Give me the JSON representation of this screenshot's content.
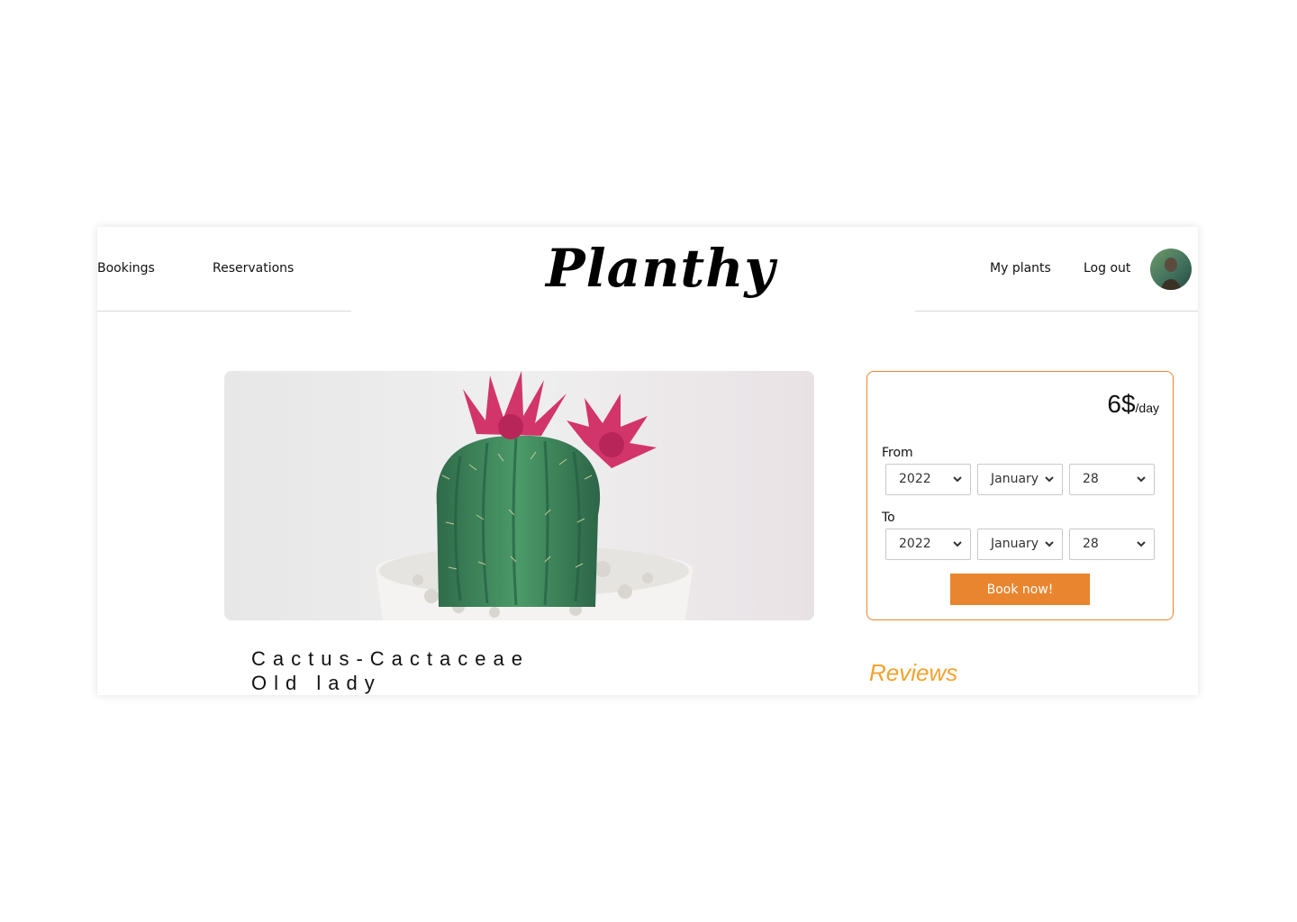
{
  "nav": {
    "bookings": "Bookings",
    "reservations": "Reservations",
    "logo": "Planthy",
    "my_plants": "My plants",
    "log_out": "Log out"
  },
  "plant": {
    "name_line1": "Cactus-Cactaceae",
    "name_line2": "Old lady"
  },
  "booking": {
    "price_value": "6$",
    "price_unit": "/day",
    "from_label": "From",
    "to_label": "To",
    "from": {
      "year": "2022",
      "month": "January",
      "day": "28"
    },
    "to": {
      "year": "2022",
      "month": "January",
      "day": "28"
    },
    "book_label": "Book now!"
  },
  "reviews": {
    "heading": "Reviews"
  },
  "colors": {
    "accent": "#e9852f",
    "reviews": "#f3a22f",
    "flower": "#d2356a",
    "cactus": "#3f8a5e"
  }
}
